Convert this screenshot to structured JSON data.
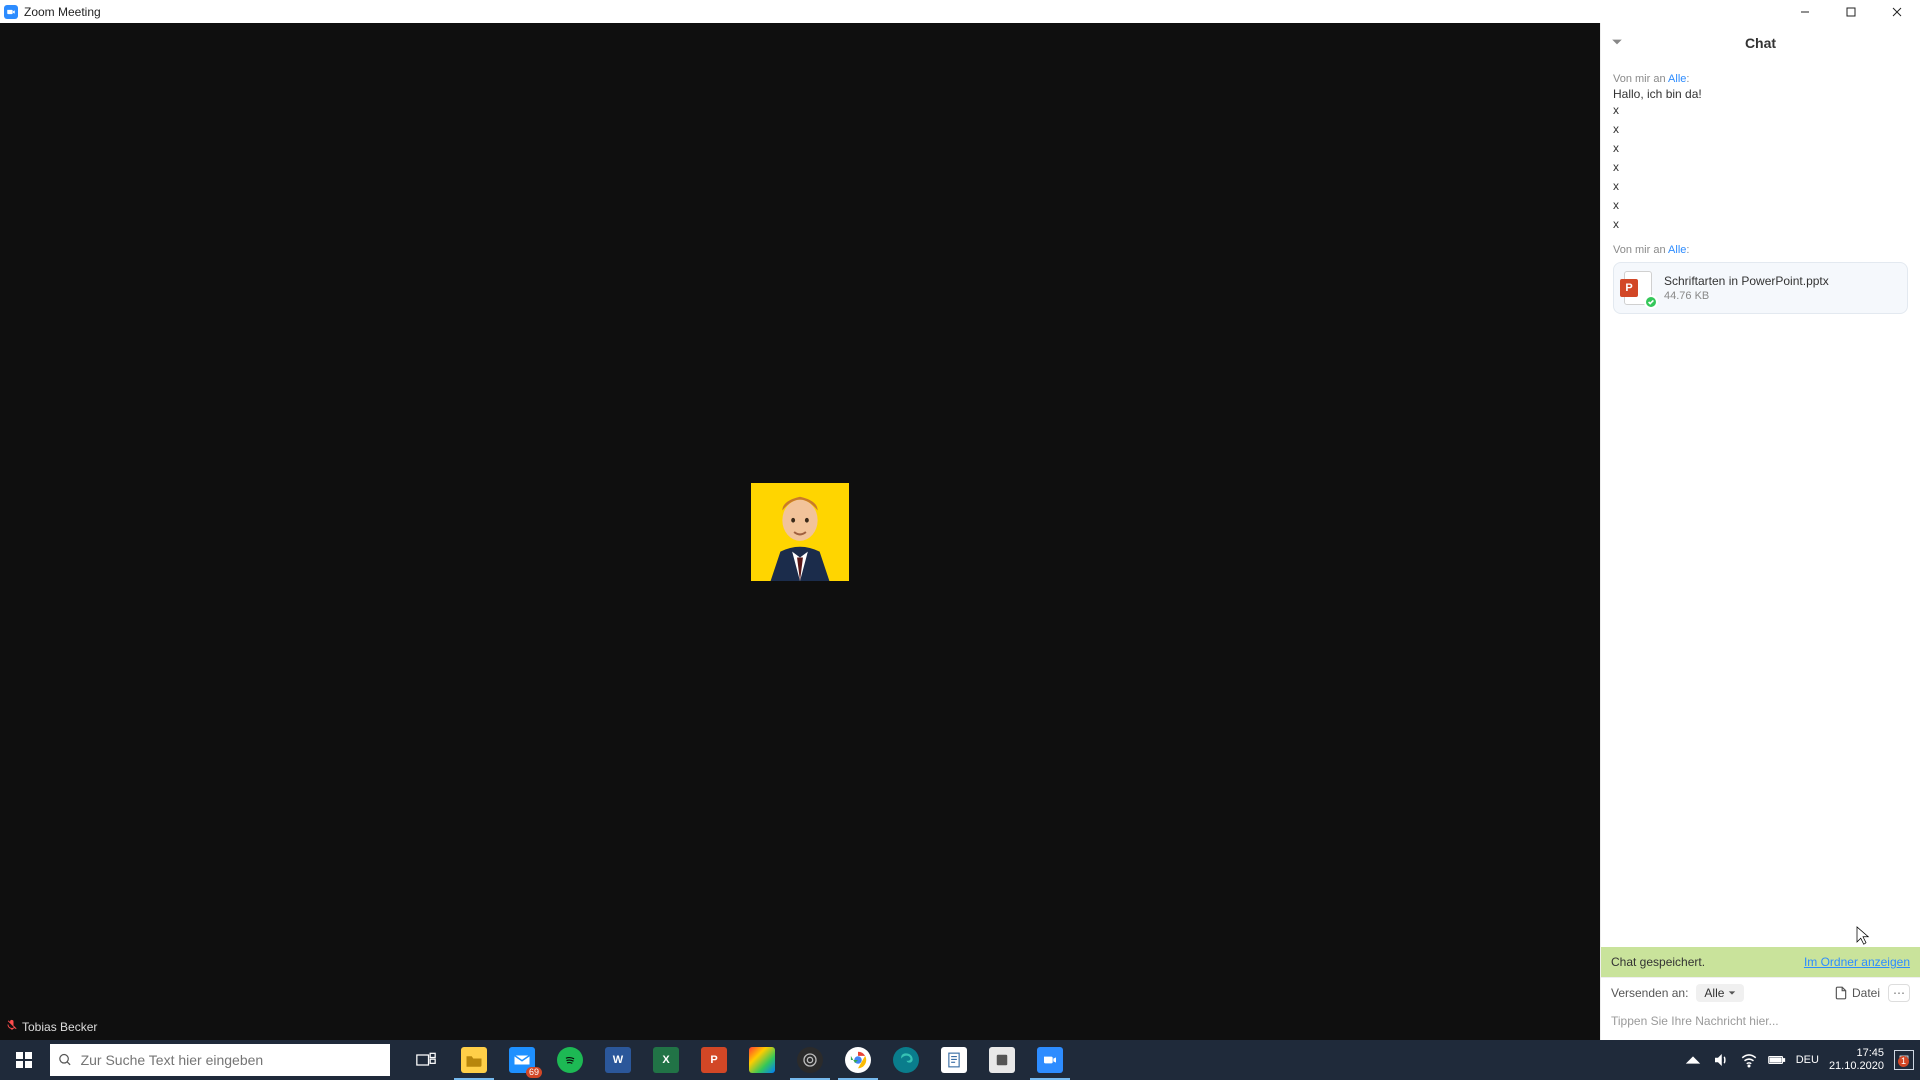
{
  "window": {
    "title": "Zoom Meeting"
  },
  "participant": {
    "name": "Tobias Becker"
  },
  "chat": {
    "title": "Chat",
    "messages": [
      {
        "from": "Von mir an",
        "to": "Alle",
        "to_suffix": ":",
        "lines": [
          "Hallo, ich bin da!",
          "x",
          "x",
          "x",
          "x",
          "x",
          "x",
          "x"
        ]
      }
    ],
    "file_msg": {
      "from": "Von mir an",
      "to": "Alle",
      "to_suffix": ":",
      "filename": "Schriftarten in PowerPoint.pptx",
      "filesize": "44.76 KB"
    },
    "saved_notice": "Chat gespeichert.",
    "saved_link": "Im Ordner anzeigen",
    "send_to_label": "Versenden an:",
    "send_to_target": "Alle",
    "file_button": "Datei",
    "input_placeholder": "Tippen Sie Ihre Nachricht hier..."
  },
  "taskbar": {
    "search_placeholder": "Zur Suche Text hier eingeben",
    "mail_badge": "69",
    "lang": "DEU",
    "time": "17:45",
    "date": "21.10.2020",
    "notif_badge": "1"
  }
}
